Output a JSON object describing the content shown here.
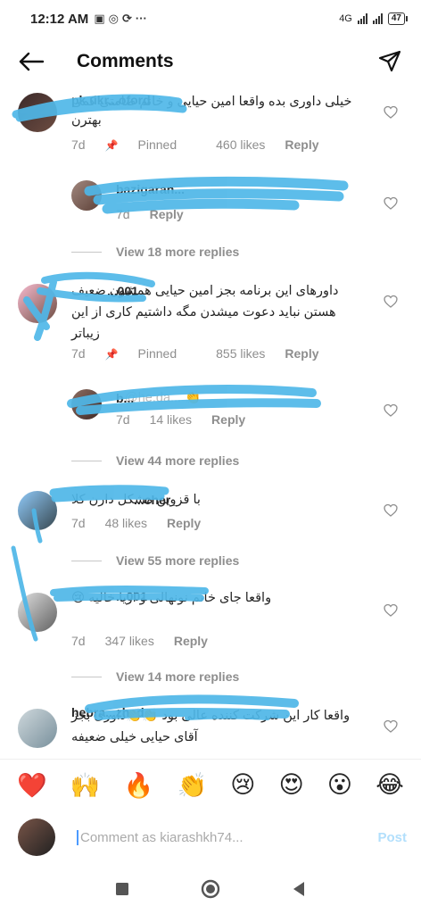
{
  "status_bar": {
    "time": "12:12 AM",
    "signal_label": "4G",
    "battery": "47"
  },
  "header": {
    "title": "Comments"
  },
  "comments": [
    {
      "username": "pk.ukr...oford",
      "text": "خیلی داوری بده واقعا امین حیایی و خانم صامتی کمی بهترن",
      "age": "7d",
      "pinned": "Pinned",
      "likes": "460 likes",
      "reply": "Reply"
    },
    {
      "username": "bazigaran...",
      "text": "@...",
      "age": "7d",
      "likes": "",
      "reply": "Reply"
    },
    {
      "username": "...001",
      "text": "داورهای این برنامه بجز امین حیایی همشون ضعیف هستن نباید دعوت میشدن مگه داشتیم کاری از این زیباتر",
      "age": "7d",
      "pinned": "Pinned",
      "likes": "855 likes",
      "reply": "Reply"
    },
    {
      "username": "b...",
      "text": "@he.da... 👏",
      "age": "7d",
      "likes": "14 likes",
      "reply": "Reply"
    },
    {
      "username": "...cher_",
      "text": "با قزوین مشکل دارن کلا",
      "age": "7d",
      "likes": "48 likes",
      "reply": "Reply"
    },
    {
      "username": "...001",
      "text": "واقعا جای خانم نونهالی و اریا خالیه 😢",
      "age": "7d",
      "likes": "347 likes",
      "reply": "Reply"
    },
    {
      "username": "hebra...zhad",
      "text": "واقعا کار این شرکت کننده عالی بود 👏👏داوری بجز آقای حیایی خیلی ضعیفه",
      "age": "",
      "likes": "",
      "reply": ""
    }
  ],
  "view_replies": [
    "View 18 more replies",
    "View 44 more replies",
    "View 55 more replies",
    "View 14 more replies"
  ],
  "reactions": [
    "❤️",
    "🙌",
    "🔥",
    "👏",
    "😢",
    "😍",
    "😮",
    "😂"
  ],
  "composer": {
    "placeholder": "Comment as kiarashkh74...",
    "post_label": "Post"
  },
  "colors": {
    "scribble": "#4fb7e8",
    "muted_text": "#8e8e8e",
    "post": "#b2dffc"
  }
}
